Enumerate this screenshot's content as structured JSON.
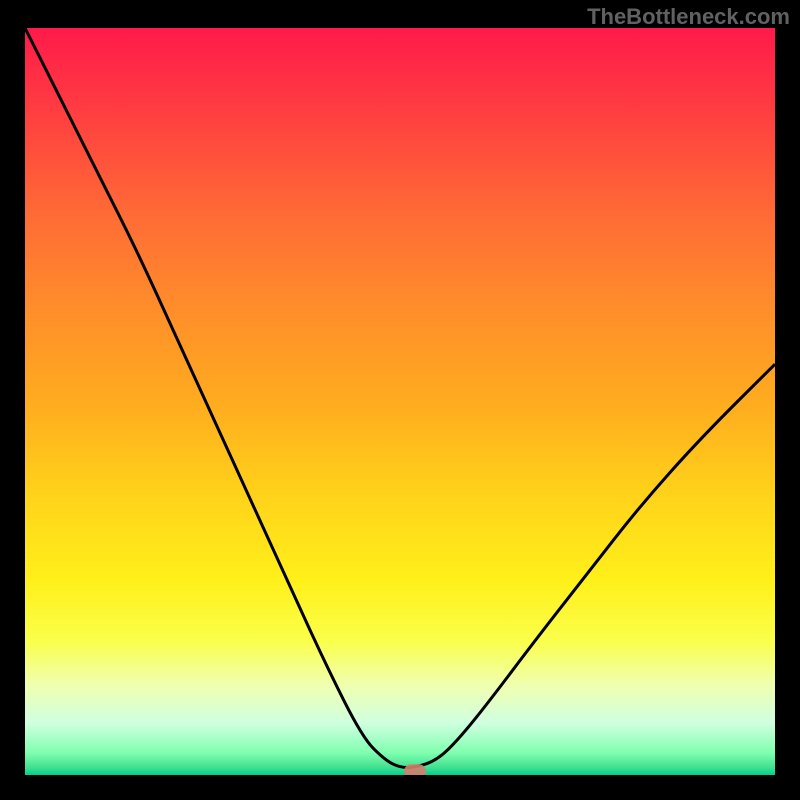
{
  "watermark": "TheBottleneck.com",
  "chart_data": {
    "type": "line",
    "title": "",
    "xlabel": "",
    "ylabel": "",
    "xlim": [
      0,
      100
    ],
    "ylim": [
      0,
      100
    ],
    "series": [
      {
        "name": "bottleneck-curve",
        "x": [
          0,
          5,
          10,
          15,
          20,
          25,
          30,
          35,
          40,
          45,
          48,
          50,
          52,
          55,
          58,
          62,
          68,
          75,
          82,
          90,
          100
        ],
        "y": [
          100,
          90,
          80,
          70,
          59,
          48,
          37,
          26,
          15,
          5,
          2,
          1,
          1,
          2,
          5,
          10,
          18,
          27,
          36,
          45,
          55
        ]
      }
    ],
    "marker": {
      "x": 52,
      "y": 0.5
    },
    "background_gradient": {
      "top": "#ff1a4a",
      "bottom": "#00d090"
    }
  }
}
